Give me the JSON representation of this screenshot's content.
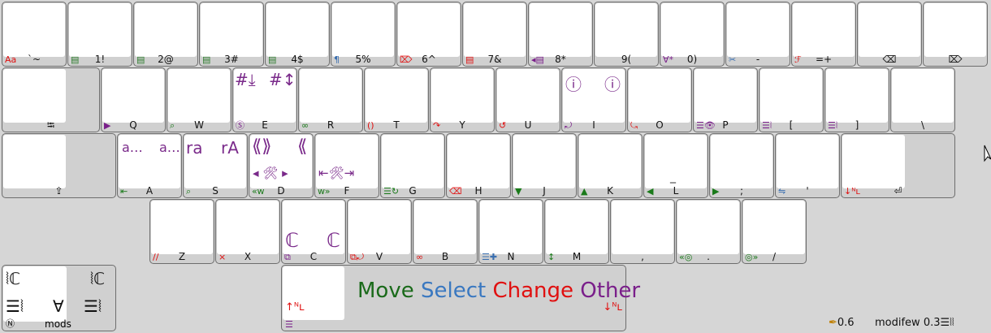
{
  "row1": [
    {
      "label": "`~",
      "icon": "Aa",
      "icon_color": "#e01010"
    },
    {
      "label": "1!",
      "icon": "▤",
      "icon_color": "#2a7a2a"
    },
    {
      "label": "2@",
      "icon": "▤",
      "icon_color": "#2a7a2a"
    },
    {
      "label": "3#",
      "icon": "▤",
      "icon_color": "#2a7a2a"
    },
    {
      "label": "4$",
      "icon": "▤",
      "icon_color": "#2a7a2a"
    },
    {
      "label": "5%",
      "icon": "¶",
      "icon_color": "#3a6fb0"
    },
    {
      "label": "6^",
      "icon": "⌦",
      "icon_color": "#e01010"
    },
    {
      "label": "7&",
      "icon": "▤",
      "icon_color": "#e01010"
    },
    {
      "label": "8*",
      "icon": "◂▤",
      "icon_color": "#7a1f8a"
    },
    {
      "label": "9(",
      "icon": "",
      "icon_color": "#7a1f8a"
    },
    {
      "label": "0)",
      "icon": "∀*",
      "icon_color": "#7a1f8a"
    },
    {
      "label": "-",
      "icon": "✂",
      "icon_color": "#3a6fb0"
    },
    {
      "label": "=+",
      "icon": "ℱ",
      "icon_color": "#e01010"
    },
    {
      "label": "⌫",
      "icon": "",
      "icon_color": "#111"
    },
    {
      "label": "⌦",
      "icon": "",
      "icon_color": "#111"
    }
  ],
  "row2": [
    {
      "label": "⭾",
      "icon": "",
      "icon_color": "#111"
    },
    {
      "label": "Q",
      "icon": "▶",
      "icon_color": "#7a1f8a"
    },
    {
      "label": "W",
      "icon": "⌕",
      "icon_color": "#1a7a1a"
    },
    {
      "label": "E",
      "icon": "Ⓢ",
      "icon_color": "#7a1f8a"
    },
    {
      "label": "R",
      "icon": "∞",
      "icon_color": "#1a7a1a"
    },
    {
      "label": "T",
      "icon": "()",
      "icon_color": "#e01010"
    },
    {
      "label": "Y",
      "icon": "↷",
      "icon_color": "#e01010"
    },
    {
      "label": "U",
      "icon": "↺",
      "icon_color": "#e01010"
    },
    {
      "label": "I",
      "icon": "⤾",
      "icon_color": "#7a1f8a"
    },
    {
      "label": "O",
      "icon": "⤿",
      "icon_color": "#e01010"
    },
    {
      "label": "P",
      "icon": "☰👁",
      "icon_color": "#7a1f8a"
    },
    {
      "label": "[",
      "icon": "☰⦚",
      "icon_color": "#7a1f8a"
    },
    {
      "label": "]",
      "icon": "☰⦚",
      "icon_color": "#7a1f8a"
    },
    {
      "label": "\\",
      "icon": "",
      "icon_color": "#111"
    }
  ],
  "row3": [
    {
      "label": "⇪",
      "icon": "",
      "icon_color": "#111"
    },
    {
      "label": "A",
      "icon": "⇤",
      "icon_color": "#1a7a1a"
    },
    {
      "label": "S",
      "icon": "⌕",
      "icon_color": "#1a7a1a"
    },
    {
      "label": "D",
      "icon": "«w",
      "icon_color": "#1a7a1a"
    },
    {
      "label": "F",
      "icon": "w»",
      "icon_color": "#1a7a1a"
    },
    {
      "label": "G",
      "icon": "☰↻",
      "icon_color": "#1a7a1a"
    },
    {
      "label": "H",
      "icon": "⌫",
      "icon_color": "#e01010"
    },
    {
      "label": "J",
      "icon": "▼",
      "icon_color": "#1a7a1a"
    },
    {
      "label": "K",
      "icon": "▲",
      "icon_color": "#1a7a1a"
    },
    {
      "label": "L",
      "icon": "◀",
      "icon_color": "#1a7a1a"
    },
    {
      "label": ";",
      "icon": "▶",
      "icon_color": "#1a7a1a"
    },
    {
      "label": "'",
      "icon": "⇋",
      "icon_color": "#3a6fb0"
    },
    {
      "label": "⏎",
      "icon": "↓ᴺʟ",
      "icon_color": "#e01010"
    }
  ],
  "row4": [
    {
      "label": "Z",
      "icon": "//",
      "icon_color": "#e01010"
    },
    {
      "label": "X",
      "icon": "×",
      "icon_color": "#e01010"
    },
    {
      "label": "C",
      "icon": "⧉",
      "icon_color": "#7a1f8a"
    },
    {
      "label": "V",
      "icon": "⧉⤾",
      "icon_color": "#e01010"
    },
    {
      "label": "B",
      "icon": "∞",
      "icon_color": "#e01010"
    },
    {
      "label": "N",
      "icon": "☰✚",
      "icon_color": "#3a6fb0"
    },
    {
      "label": "M",
      "icon": "↕",
      "icon_color": "#1a7a1a"
    },
    {
      "label": ",",
      "icon": "",
      "icon_color": "#111"
    },
    {
      "label": ".",
      "icon": "«◎",
      "icon_color": "#1a7a1a"
    },
    {
      "label": "/",
      "icon": "◎»",
      "icon_color": "#1a7a1a"
    }
  ],
  "overlays": {
    "e_left": "#⤓",
    "e_right": "#↕",
    "i_left": "ⓘ",
    "i_right": "ⓘ",
    "a_left": "a…",
    "a_right": "a…",
    "s_left": "ra",
    "s_right": "rA",
    "d_top_left": "⟪⟫",
    "d_top_right": "⟪",
    "d_bottom": "◂ 🛠 ▸",
    "f_bottom": "⇤🛠⇥",
    "l_mid": "_",
    "c_left": "ℂ",
    "c_right": "ℂ"
  },
  "mods": {
    "label": "mods",
    "top_left": "⦚ℂ",
    "top_right": "⦚ℂ",
    "bottom_left": "☰⦚",
    "bottom_mid": "∀",
    "bottom_right": "☰⦚",
    "corner": "Ⓝ"
  },
  "space": {
    "left_icon": "↑ᴺʟ",
    "right_icon": "↓ᴺʟ",
    "bottom_icon": "☰",
    "legend": [
      {
        "text": "Move",
        "color": "#1a6a1a"
      },
      {
        "text": "Select",
        "color": "#3a78c0"
      },
      {
        "text": "Change",
        "color": "#e01010"
      },
      {
        "text": "Other",
        "color": "#7a1f8a"
      }
    ]
  },
  "status": {
    "version_left": "0.6",
    "version_right": "modifew 0.3☰⦚⦚"
  }
}
